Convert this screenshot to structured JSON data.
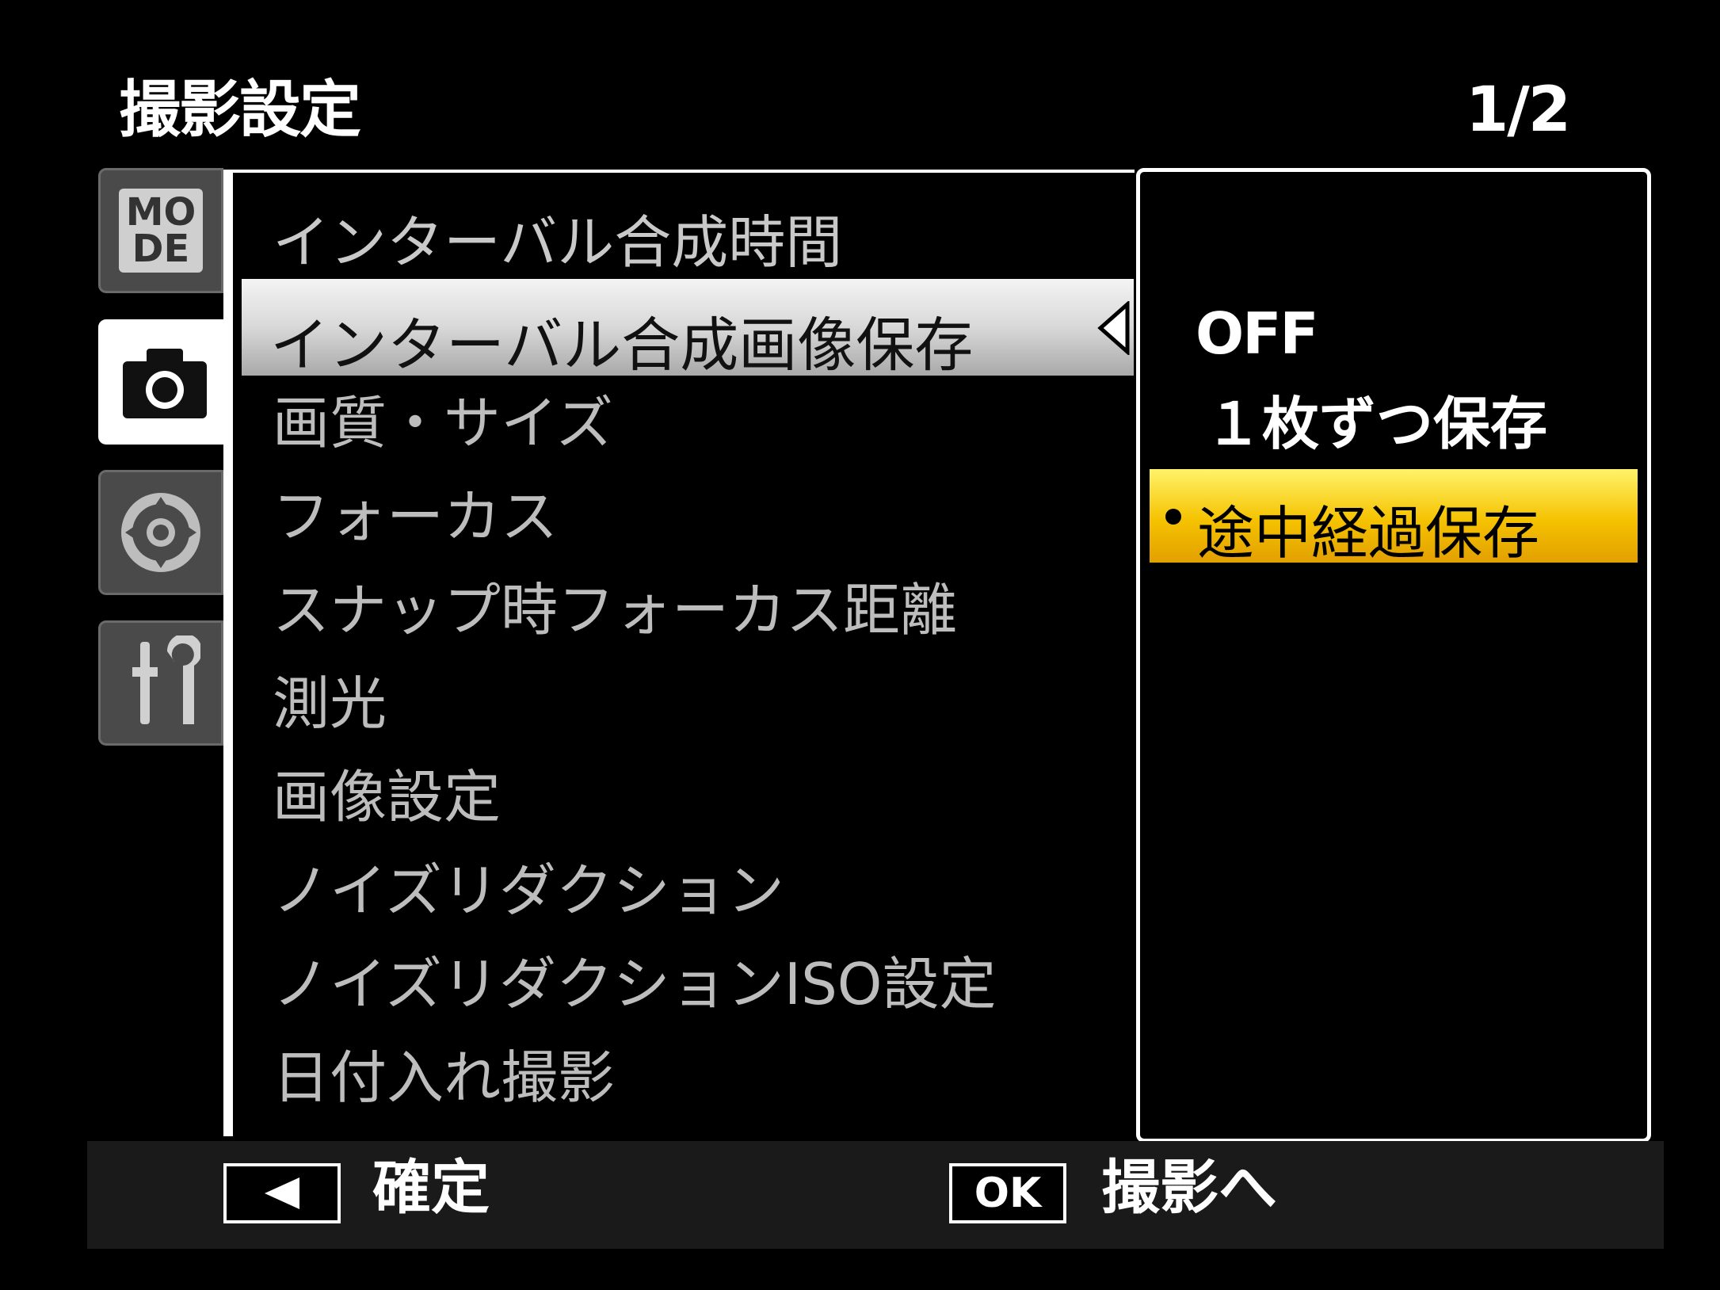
{
  "header": {
    "title": "撮影設定",
    "page": "1/2"
  },
  "tabs": {
    "mode_label_top": "MO",
    "mode_label_bottom": "DE"
  },
  "menu": {
    "items": [
      "インターバル合成時間",
      "インターバル合成画像保存",
      "画質・サイズ",
      "フォーカス",
      "スナップ時フォーカス距離",
      "測光",
      "画像設定",
      "ノイズリダクション",
      "ノイズリダクションISO設定",
      "日付入れ撮影"
    ],
    "selected_index": 1
  },
  "submenu": {
    "options": [
      "OFF",
      "１枚ずつ保存",
      "途中経過保存"
    ],
    "selected_index": 2
  },
  "footer": {
    "confirm_label": "確定",
    "ok_key": "OK",
    "shoot_label": "撮影へ"
  }
}
